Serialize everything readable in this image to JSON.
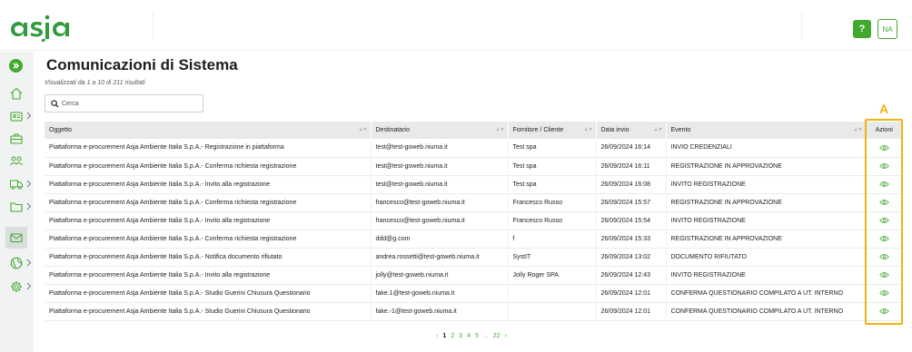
{
  "brand": {
    "logo_text": "asja",
    "accent": "#43a82e",
    "highlight": "#f0b312"
  },
  "header": {
    "help_label": "?",
    "user_initials": "NA"
  },
  "sidebar": {
    "items": [
      {
        "icon": "expand-icon"
      },
      {
        "icon": "home-icon"
      },
      {
        "icon": "id-card-icon"
      },
      {
        "icon": "briefcase-icon"
      },
      {
        "icon": "users-icon"
      },
      {
        "icon": "truck-icon"
      },
      {
        "icon": "folder-icon"
      },
      {
        "icon": "mail-icon"
      },
      {
        "icon": "globe-icon"
      },
      {
        "icon": "gear-icon"
      }
    ]
  },
  "main": {
    "title": "Comunicazioni di Sistema",
    "results_info": "Visualizzati da 1 a 10 di 211 risultati",
    "search_placeholder": "Cerca",
    "annotation_letter": "A"
  },
  "table": {
    "columns": [
      "Oggetto",
      "Destinatario",
      "Fornitore / Cliente",
      "Data invio",
      "Evento",
      "Azioni"
    ],
    "rows": [
      [
        "Piattaforma e-procurement Asja Ambiente Italia S.p.A.- Registrazione in piattaforma",
        "test@test-goweb.niuma.it",
        "Test spa",
        "26/09/2024 16:14",
        "INVIO CREDENZIALI"
      ],
      [
        "Piattaforma e-procurement Asja Ambiente Italia S.p.A.- Conferma richiesta registrazione",
        "test@test-goweb.niuma.it",
        "Test spa",
        "26/09/2024 16:11",
        "REGISTRAZIONE IN APPROVAZIONE"
      ],
      [
        "Piattaforma e-procurement Asja Ambiente Italia S.p.A.- Invito alla registrazione",
        "test@test-goweb.niuma.it",
        "Test spa",
        "26/09/2024 16:08",
        "INVITO REGISTRAZIONE"
      ],
      [
        "Piattaforma e-procurement Asja Ambiente Italia S.p.A.- Conferma richiesta registrazione",
        "francesco@test-goweb.niuma.it",
        "Francesco Russo",
        "26/09/2024 15:57",
        "REGISTRAZIONE IN APPROVAZIONE"
      ],
      [
        "Piattaforma e-procurement Asja Ambiente Italia S.p.A.- Invito alla registrazione",
        "francesco@test-goweb.niuma.it",
        "Francesco Russo",
        "26/09/2024 15:54",
        "INVITO REGISTRAZIONE"
      ],
      [
        "Piattaforma e-procurement Asja Ambiente Italia S.p.A.- Conferma richiesta registrazione",
        "ddd@g.com",
        "f",
        "26/09/2024 15:33",
        "REGISTRAZIONE IN APPROVAZIONE"
      ],
      [
        "Piattaforma e-procurement Asja Ambiente Italia S.p.A.- Notifica documento rifiutato",
        "andrea.rossetti@test-goweb.niuma.it",
        "SystIT",
        "26/09/2024 13:02",
        "DOCUMENTO RIFIUTATO"
      ],
      [
        "Piattaforma e-procurement Asja Ambiente Italia S.p.A.- Invito alla registrazione",
        "jolly@test-goweb.niuma.it",
        "Jolly Roger SPA",
        "26/09/2024 12:43",
        "INVITO REGISTRAZIONE"
      ],
      [
        "Piattaforma e-procurement Asja Ambiente Italia S.p.A.- Studio Guerini Chiusura Questionario",
        "fake.1@test-goweb.niuma.it",
        "",
        "26/09/2024 12:01",
        "CONFERMA QUESTIONARIO COMPILATO A UT. INTERNO"
      ],
      [
        "Piattaforma e-procurement Asja Ambiente Italia S.p.A.- Studio Guerini Chiusura Questionario",
        "fake.-1@test-goweb.niuma.it",
        "",
        "26/09/2024 12:01",
        "CONFERMA QUESTIONARIO COMPILATO A UT. INTERNO"
      ]
    ]
  },
  "pagination": {
    "prev": "‹",
    "pages": [
      "1",
      "2",
      "3",
      "4",
      "5"
    ],
    "ellipsis": "...",
    "last": "22",
    "next": "›"
  }
}
